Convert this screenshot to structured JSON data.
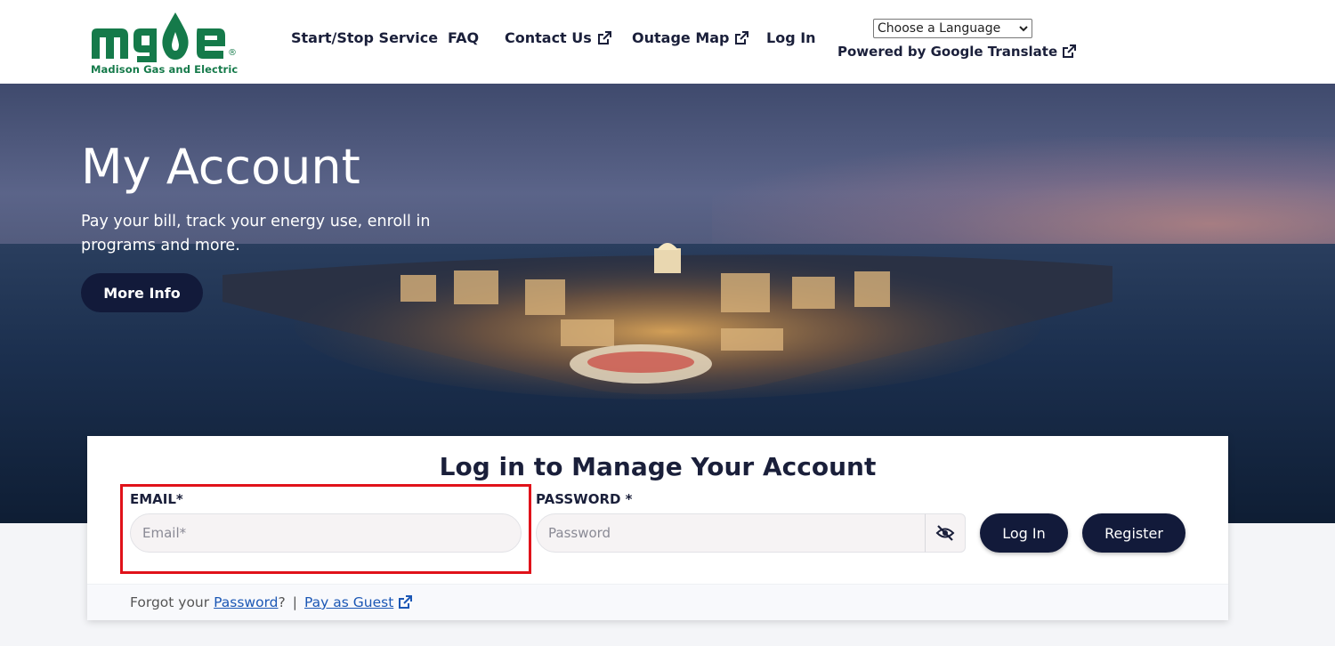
{
  "header": {
    "logo": {
      "wordmark": "MGE",
      "registered": "®",
      "subtitle": "Madison Gas and Electric"
    },
    "nav": [
      {
        "label": "Start/Stop Service",
        "external": false
      },
      {
        "label": "FAQ",
        "external": false
      },
      {
        "label": "Contact Us",
        "external": true
      },
      {
        "label": "Outage Map",
        "external": true
      },
      {
        "label": "Log In",
        "external": false
      }
    ],
    "language": {
      "selected": "Choose a Language",
      "powered_by": "Powered by Google Translate"
    }
  },
  "hero": {
    "title": "My Account",
    "text": "Pay your bill, track your energy use, enroll in programs and more.",
    "button": "More Info"
  },
  "login": {
    "title": "Log in to Manage Your Account",
    "email_label": "EMAIL*",
    "email_placeholder": "Email*",
    "password_label": "PASSWORD *",
    "password_placeholder": "Password",
    "login_button": "Log In",
    "register_button": "Register",
    "forgot_prefix": "Forgot your",
    "forgot_link": "Password",
    "forgot_suffix": "?",
    "divider": "|",
    "guest_link": "Pay as Guest"
  },
  "colors": {
    "brand_green": "#157a4a",
    "navy": "#121a3a",
    "link": "#1b57b5",
    "highlight": "#e0121a"
  }
}
